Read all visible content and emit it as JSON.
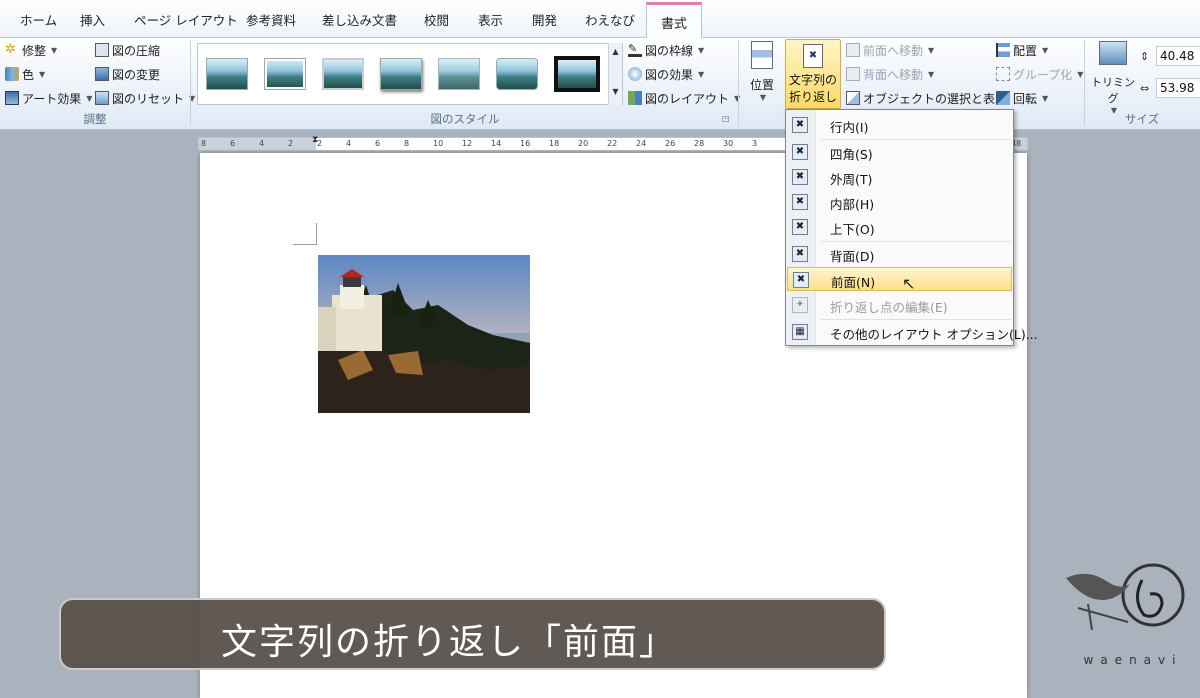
{
  "tabs": [
    "ホーム",
    "挿入",
    "ページ レイアウト",
    "参考資料",
    "差し込み文書",
    "校閲",
    "表示",
    "開発",
    "わえなび",
    "書式"
  ],
  "adjust": {
    "items": [
      "修整",
      "色",
      "アート効果",
      "図の圧縮",
      "図の変更",
      "図のリセット"
    ],
    "label": "調整"
  },
  "styles": {
    "items": [
      "図の枠線",
      "図の効果",
      "図のレイアウト"
    ],
    "label": "図のスタイル"
  },
  "arrange": {
    "position": "位置",
    "wrap_line1": "文字列の",
    "wrap_line2": "折り返し",
    "items": [
      "前面へ移動",
      "背面へ移動",
      "オブジェクトの選択と表示",
      "配置",
      "グループ化",
      "回転"
    ]
  },
  "size": {
    "trim": "トリミング",
    "height": "40.48",
    "width": "53.98",
    "label": "サイズ"
  },
  "ruler_ticks": [
    "8",
    "6",
    "4",
    "2",
    "2",
    "4",
    "6",
    "8",
    "10",
    "12",
    "14",
    "16",
    "18",
    "20",
    "22",
    "24",
    "26",
    "28",
    "30",
    "3",
    "48"
  ],
  "wrap_menu": {
    "items": [
      {
        "label": "行内(I)"
      },
      {
        "label": "四角(S)"
      },
      {
        "label": "外周(T)"
      },
      {
        "label": "内部(H)"
      },
      {
        "label": "上下(O)"
      },
      {
        "label": "背面(D)"
      },
      {
        "label": "前面(N)"
      },
      {
        "label": "折り返し点の編集(E)"
      },
      {
        "label": "その他のレイアウト オプション(L)..."
      }
    ]
  },
  "caption": "文字列の折り返し「前面」",
  "logo_text": "waenavi",
  "colors": {
    "ribbon_bg": "#dfe9f5",
    "accent_tab": "#e57bb1",
    "highlight": "#ffdf8a",
    "caption_bg": "#58504a"
  }
}
